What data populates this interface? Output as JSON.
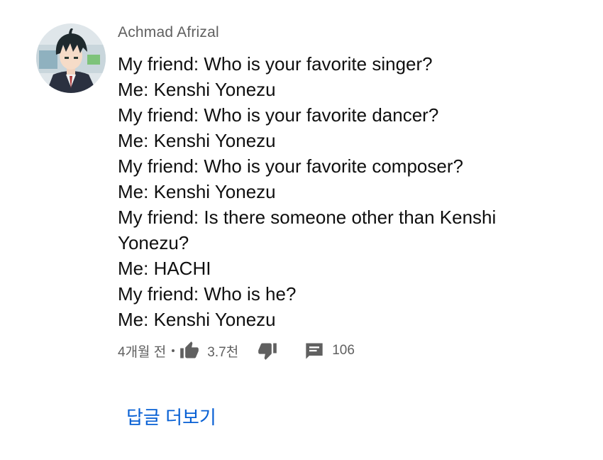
{
  "comment": {
    "author": "Achmad Afrizal",
    "lines": [
      "My friend: Who is your favorite singer?",
      "Me: Kenshi Yonezu",
      "My friend: Who is your favorite dancer?",
      "Me: Kenshi Yonezu",
      "My friend: Who is your favorite composer?",
      "Me: Kenshi Yonezu",
      "My friend: Is there someone other than Kenshi",
      "Yonezu?",
      "Me: HACHI",
      "My friend: Who is he?",
      "Me: Kenshi Yonezu"
    ],
    "timestamp": "4개월 전",
    "like_count": "3.7천",
    "reply_count": "106",
    "more_replies_label": "답글 더보기"
  },
  "icons": {
    "like": "thumbs-up-icon",
    "dislike": "thumbs-down-icon",
    "reply": "comment-icon"
  },
  "colors": {
    "text": "#0f0f0f",
    "secondary": "#606060",
    "link": "#065fd4"
  }
}
